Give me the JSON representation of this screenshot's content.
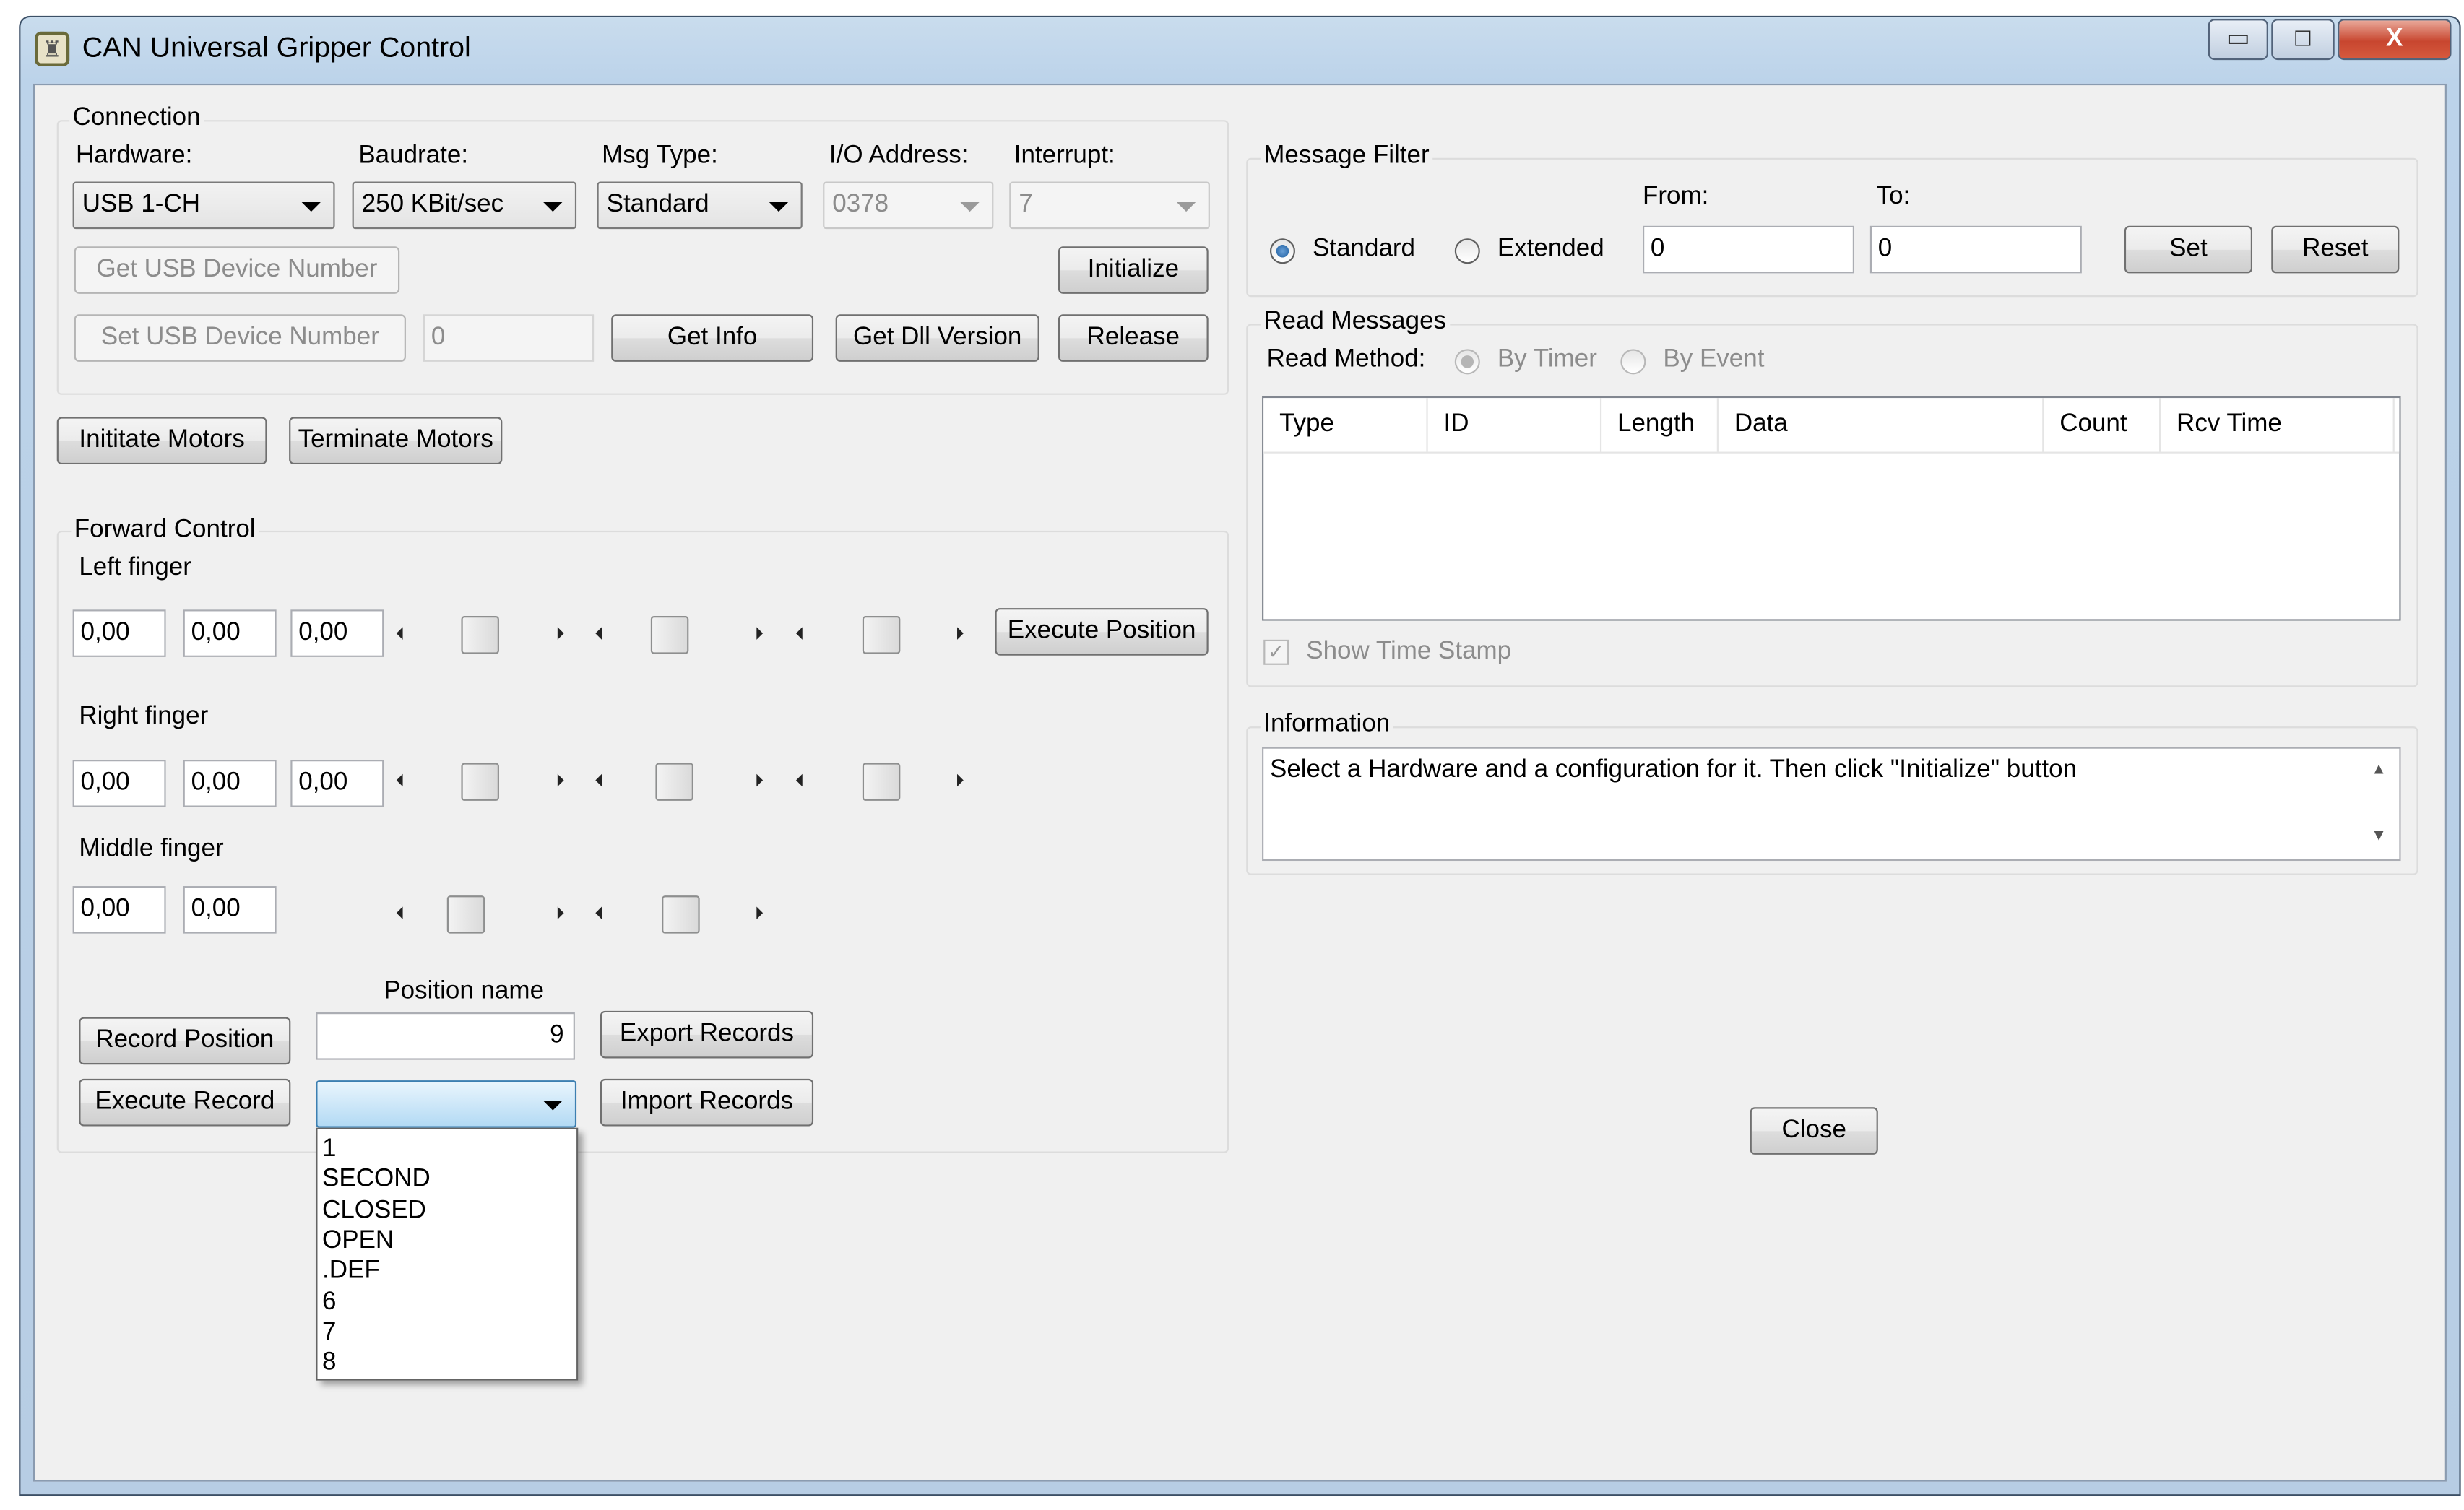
{
  "window": {
    "title": "CAN Universal Gripper Control",
    "min_glyph": "▭",
    "max_glyph": "□",
    "close_glyph": "X"
  },
  "connection": {
    "group_label": "Connection",
    "hardware_label": "Hardware:",
    "hardware_value": "USB 1-CH",
    "baudrate_label": "Baudrate:",
    "baudrate_value": "250 KBit/sec",
    "msgtype_label": "Msg Type:",
    "msgtype_value": "Standard",
    "io_label": "I/O Address:",
    "io_value": "0378",
    "interrupt_label": "Interrupt:",
    "interrupt_value": "7",
    "get_usb_label": "Get USB Device Number",
    "set_usb_label": "Set USB Device Number",
    "usb_number_value": "0",
    "initialize_label": "Initialize",
    "get_info_label": "Get Info",
    "get_dll_label": "Get Dll Version",
    "release_label": "Release"
  },
  "motors": {
    "initiate_label": "Inititate Motors",
    "terminate_label": "Terminate Motors"
  },
  "forward_control": {
    "group_label": "Forward Control",
    "left_label": "Left finger",
    "left_values": [
      "0,00",
      "0,00",
      "0,00"
    ],
    "right_label": "Right finger",
    "right_values": [
      "0,00",
      "0,00",
      "0,00"
    ],
    "middle_label": "Middle finger",
    "middle_values": [
      "0,00",
      "0,00"
    ],
    "execute_position_label": "Execute Position",
    "position_name_label": "Position name",
    "position_name_value": "9",
    "record_position_label": "Record Position",
    "export_label": "Export Records",
    "execute_record_label": "Execute Record",
    "import_label": "Import Records",
    "record_select_value": "",
    "record_options": [
      "1",
      "SECOND",
      "CLOSED",
      "OPEN",
      ".DEF",
      "6",
      "7",
      "8"
    ]
  },
  "filter": {
    "group_label": "Message Filter",
    "standard_label": "Standard",
    "extended_label": "Extended",
    "from_label": "From:",
    "from_value": "0",
    "to_label": "To:",
    "to_value": "0",
    "set_label": "Set",
    "reset_label": "Reset"
  },
  "read": {
    "group_label": "Read Messages",
    "method_label": "Read Method:",
    "by_timer_label": "By Timer",
    "by_event_label": "By Event",
    "columns": [
      "Type",
      "ID",
      "Length",
      "Data",
      "Count",
      "Rcv Time"
    ],
    "show_timestamp_label": "Show Time Stamp",
    "check_glyph": "✓"
  },
  "information": {
    "group_label": "Information",
    "text": "Select a Hardware and a configuration for it. Then click \"Initialize\" button"
  },
  "close_label": "Close",
  "colors": {
    "titlebar": "#bcd3ea",
    "client": "#f0f0f0",
    "close_button": "#c8462f"
  }
}
